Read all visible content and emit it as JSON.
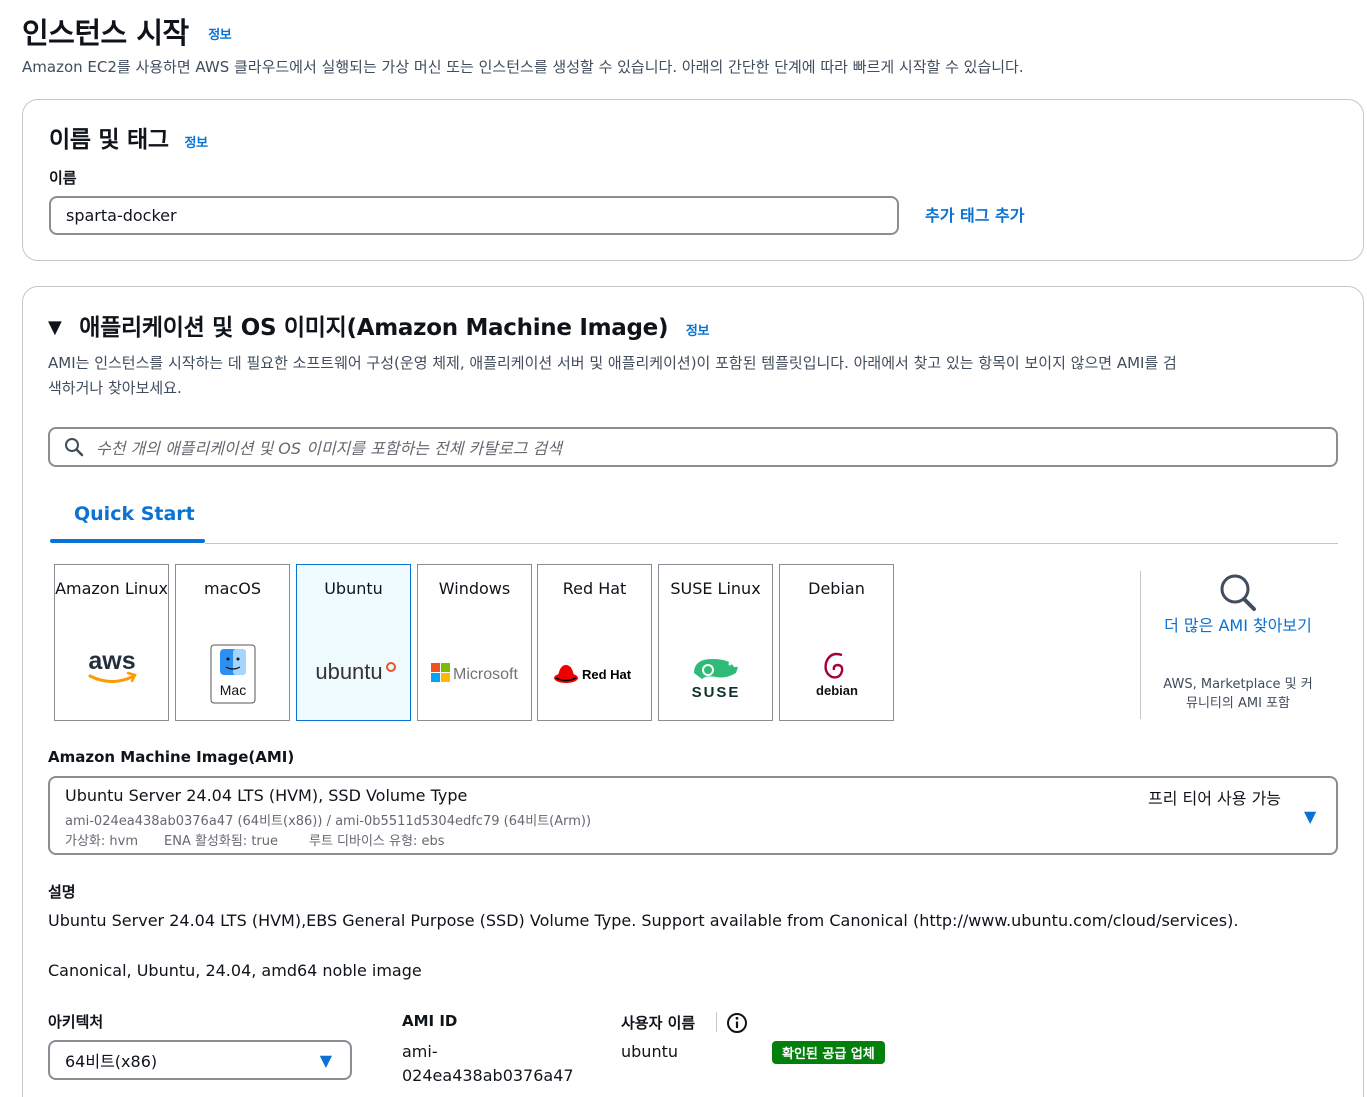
{
  "header": {
    "title": "인스턴스 시작",
    "info": "정보",
    "subtitle": "Amazon EC2를 사용하면 AWS 클라우드에서 실행되는 가상 머신 또는 인스턴스를 생성할 수 있습니다. 아래의 간단한 단계에 따라 빠르게 시작할 수 있습니다."
  },
  "name_tags": {
    "title": "이름 및 태그",
    "info": "정보",
    "name_label": "이름",
    "name_value": "sparta-docker",
    "add_tags": "추가 태그 추가"
  },
  "ami_section": {
    "title": "애플리케이션 및 OS 이미지(Amazon Machine Image)",
    "info": "정보",
    "description_line1": "AMI는 인스턴스를 시작하는 데 필요한 소프트웨어 구성(운영 체제, 애플리케이션 서버 및 애플리케이션)이 포함된 템플릿입니다. 아래에서 찾고 있는 항목이 보이지 않으면 AMI를 검",
    "description_line2": "색하거나 찾아보세요.",
    "search_placeholder": "수천 개의 애플리케이션 및 OS 이미지를 포함하는 전체 카탈로그 검색",
    "tab_quick_start": "Quick Start",
    "tiles": [
      {
        "name": "Amazon Linux",
        "logo": "aws"
      },
      {
        "name": "macOS",
        "logo": "Mac"
      },
      {
        "name": "Ubuntu",
        "logo": "ubuntu",
        "selected": true
      },
      {
        "name": "Windows",
        "logo": "Microsoft"
      },
      {
        "name": "Red Hat",
        "logo": "Red Hat"
      },
      {
        "name": "SUSE Linux",
        "logo": "SUSE"
      },
      {
        "name": "Debian",
        "logo": "debian"
      }
    ],
    "browse_more": "더 많은 AMI 찾아보기",
    "browse_more_sub": "AWS, Marketplace 및 커뮤니티의 AMI 포함",
    "ami_label": "Amazon Machine Image(AMI)",
    "ami_name": "Ubuntu Server 24.04 LTS (HVM), SSD Volume Type",
    "ami_ids": "ami-024ea438ab0376a47 (64비트(x86)) / ami-0b5511d5304edfc79 (64비트(Arm))",
    "ami_virt": "가상화: hvm",
    "ami_ena": "ENA 활성화됨: true",
    "ami_root": "루트 디바이스 유형: ebs",
    "free_tier": "프리 티어 사용 가능",
    "desc_label": "설명",
    "desc_line1": "Ubuntu Server 24.04 LTS (HVM),EBS General Purpose (SSD) Volume Type. Support available from Canonical (http://www.ubuntu.com/cloud/services).",
    "desc_line2": "Canonical, Ubuntu, 24.04, amd64 noble image",
    "arch_label": "아키텍처",
    "arch_value": "64비트(x86)",
    "ami_id_label": "AMI ID",
    "ami_id_value_1": "ami-",
    "ami_id_value_2": "024ea438ab0376a47",
    "username_label": "사용자 이름",
    "username_value": "ubuntu",
    "verified_badge": "확인된 공급 업체"
  },
  "colors": {
    "link": "#0972d3",
    "badge": "#037f0c",
    "border": "#8c8c94",
    "selected_bg": "#f0fbff"
  }
}
